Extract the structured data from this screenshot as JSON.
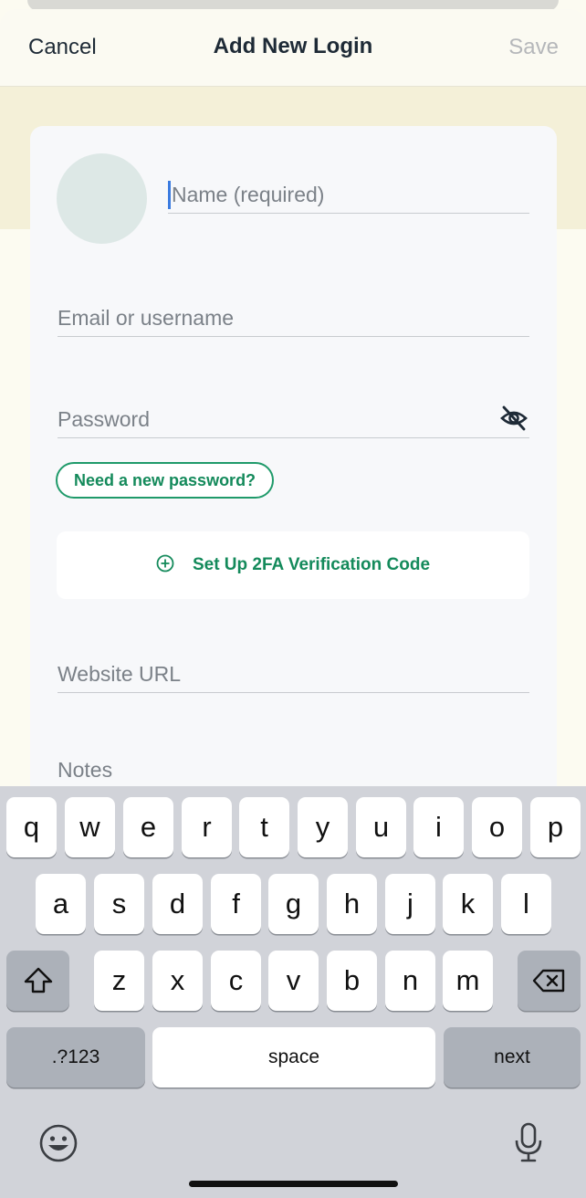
{
  "navbar": {
    "cancel": "Cancel",
    "title": "Add New Login",
    "save": "Save"
  },
  "form": {
    "name_placeholder": "Name (required)",
    "email_placeholder": "Email or username",
    "password_placeholder": "Password",
    "password_suggest": "Need a new password?",
    "twofa_label": "Set Up 2FA Verification Code",
    "website_placeholder": "Website URL",
    "notes_label": "Notes"
  },
  "keyboard": {
    "row1": [
      "q",
      "w",
      "e",
      "r",
      "t",
      "y",
      "u",
      "i",
      "o",
      "p"
    ],
    "row2": [
      "a",
      "s",
      "d",
      "f",
      "g",
      "h",
      "j",
      "k",
      "l"
    ],
    "row3": [
      "z",
      "x",
      "c",
      "v",
      "b",
      "n",
      "m"
    ],
    "numbers": ".?123",
    "space": "space",
    "next": "next"
  },
  "colors": {
    "accent": "#148a5b",
    "band": "#f4f0d8",
    "keyboard_bg": "#d1d3d9"
  },
  "icons": {
    "password_toggle": "eye-slash-icon",
    "twofa": "plus-circle-icon",
    "shift": "shift-icon",
    "delete": "backspace-icon",
    "emoji": "emoji-icon",
    "dictation": "microphone-icon"
  }
}
